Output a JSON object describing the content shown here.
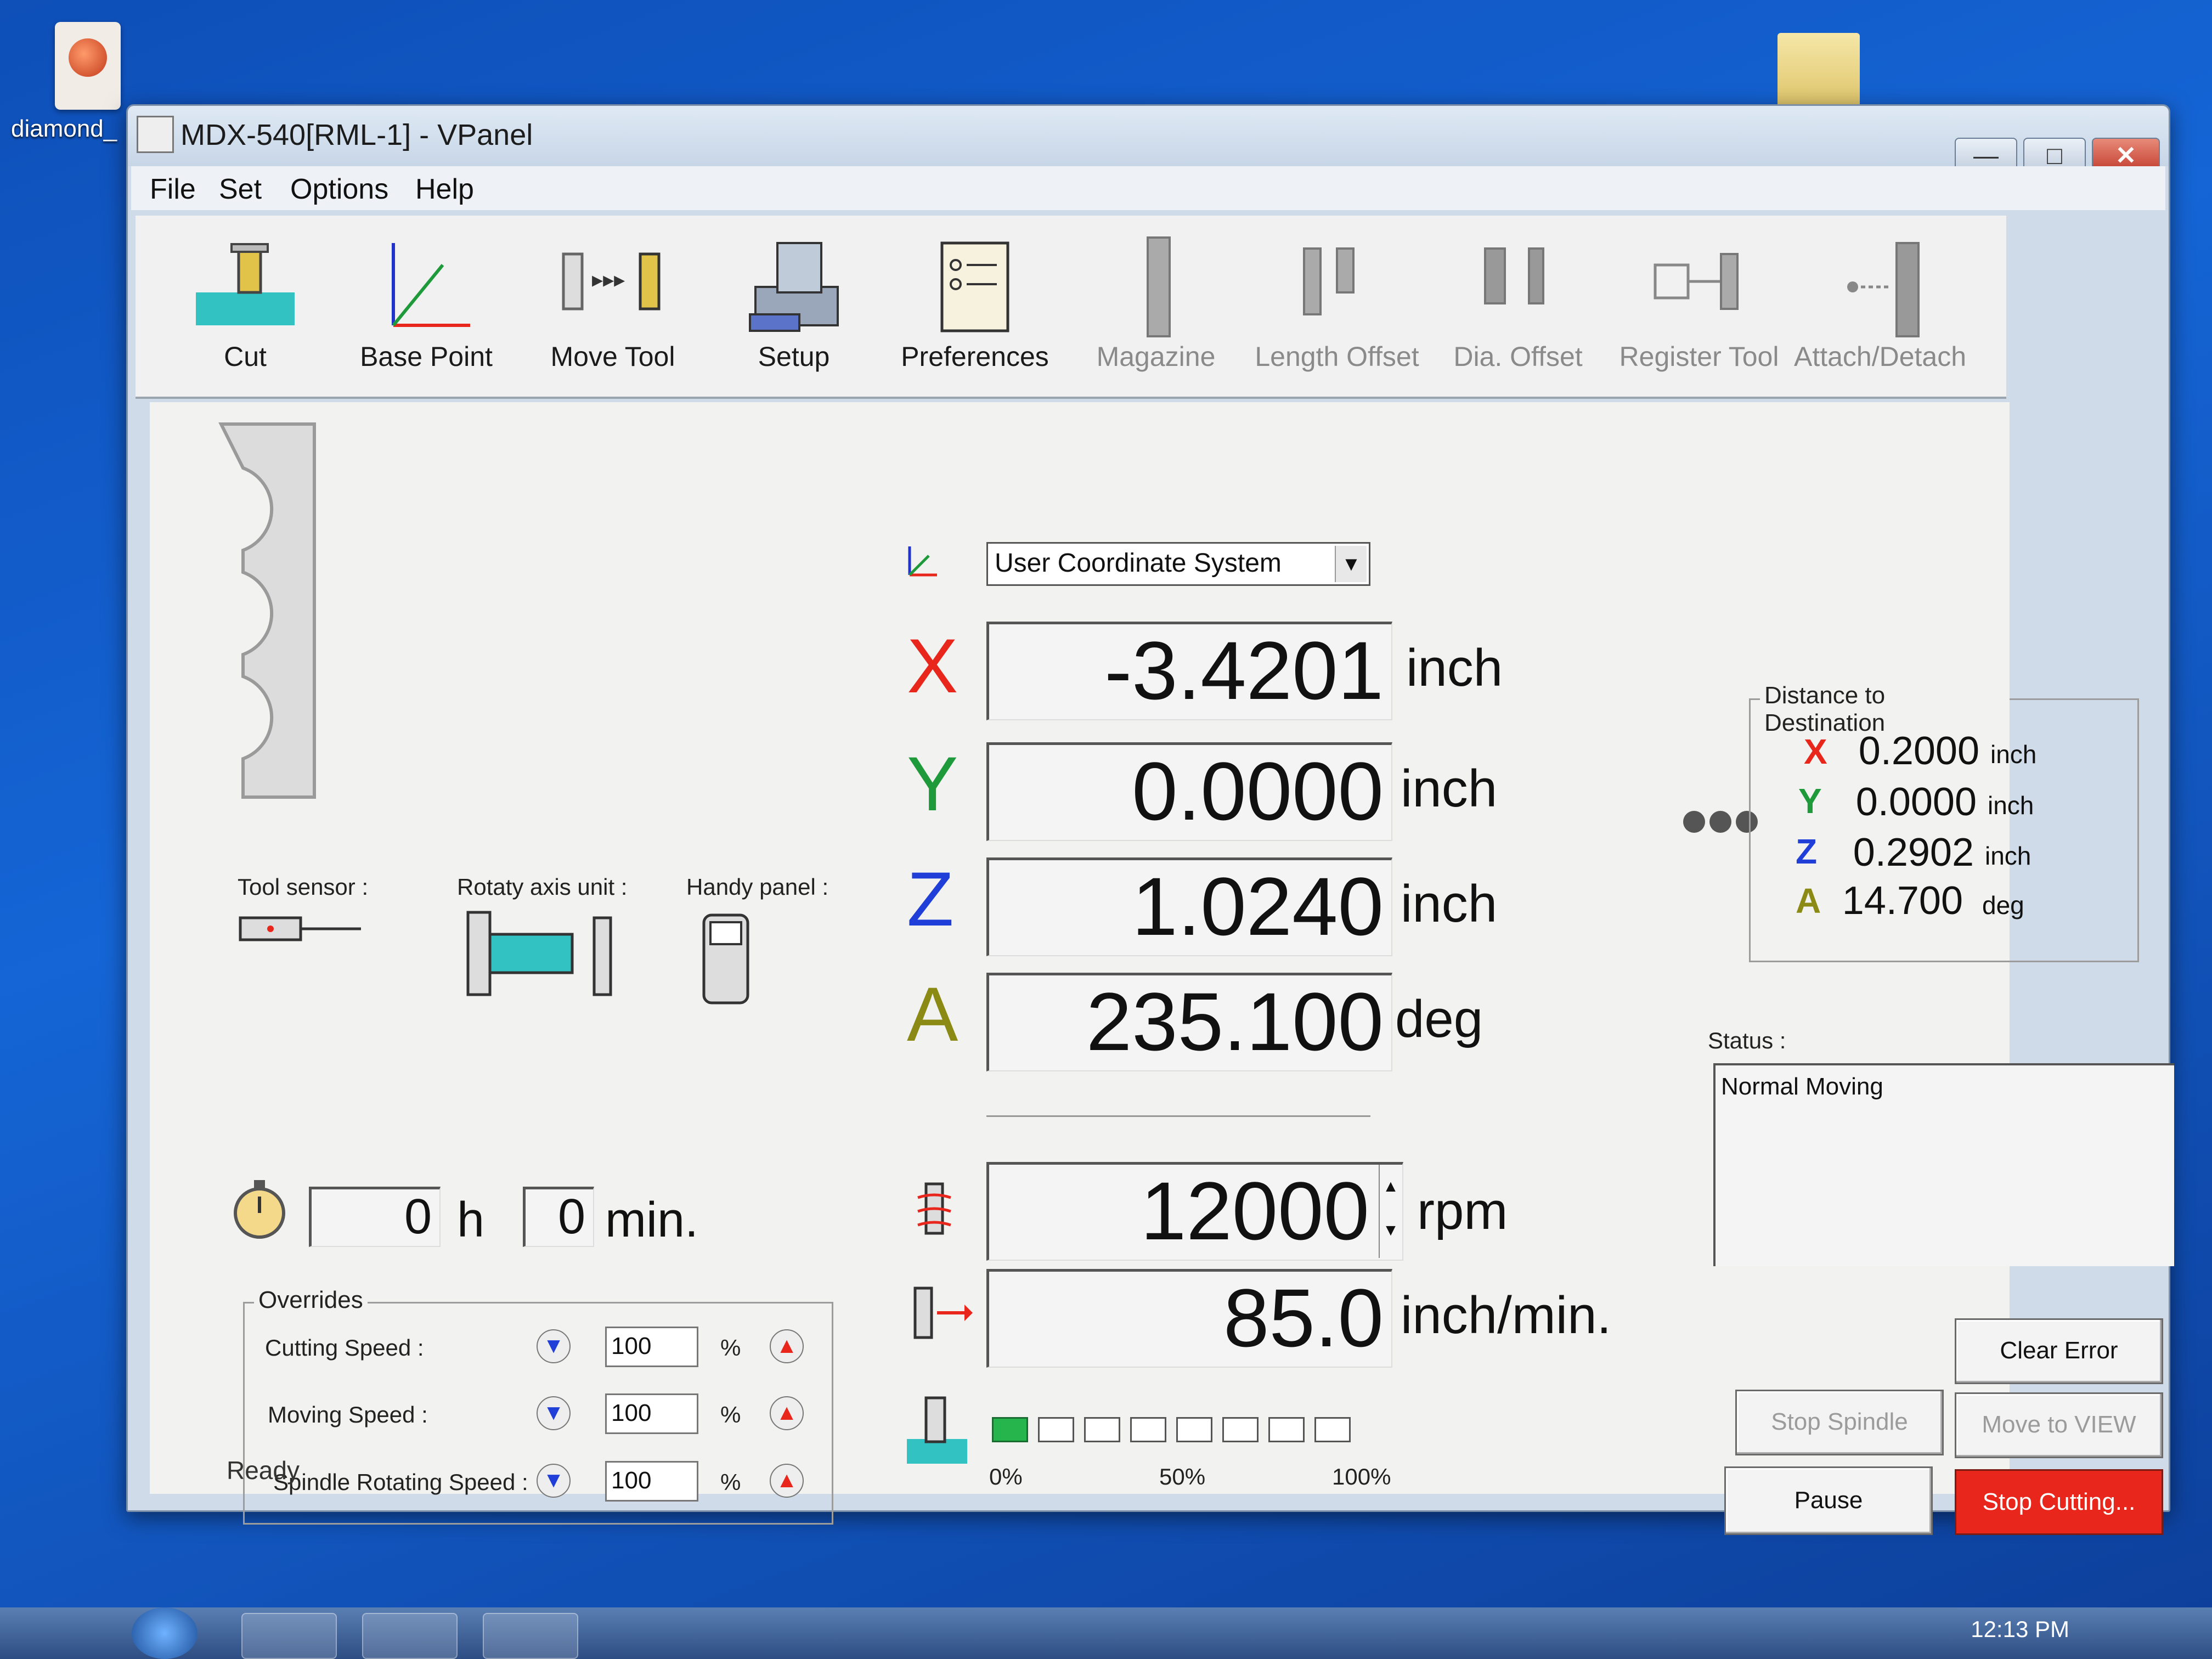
{
  "desktop": {
    "icon_label": "diamond_",
    "clock": "12:13 PM"
  },
  "window": {
    "title": "MDX-540[RML-1] - VPanel",
    "menu": [
      "File",
      "Set",
      "Options",
      "Help"
    ]
  },
  "toolbar": [
    {
      "label": "Cut",
      "icon": "cut-icon",
      "enabled": true
    },
    {
      "label": "Base Point",
      "icon": "base-point-icon",
      "enabled": true
    },
    {
      "label": "Move Tool",
      "icon": "move-tool-icon",
      "enabled": true
    },
    {
      "label": "Setup",
      "icon": "setup-icon",
      "enabled": true
    },
    {
      "label": "Preferences",
      "icon": "preferences-icon",
      "enabled": true
    },
    {
      "label": "Magazine",
      "icon": "magazine-icon",
      "enabled": false
    },
    {
      "label": "Length Offset",
      "icon": "length-offset-icon",
      "enabled": false
    },
    {
      "label": "Dia. Offset",
      "icon": "dia-offset-icon",
      "enabled": false
    },
    {
      "label": "Register Tool",
      "icon": "register-tool-icon",
      "enabled": false
    },
    {
      "label": "Attach/Detach",
      "icon": "attach-detach-icon",
      "enabled": false
    }
  ],
  "coordinate_system": "User Coordinate System",
  "axes": [
    {
      "axis": "X",
      "value": "-3.4201",
      "unit": "inch",
      "color": "#e8261c"
    },
    {
      "axis": "Y",
      "value": "0.0000",
      "unit": "inch",
      "color": "#1f9a3a"
    },
    {
      "axis": "Z",
      "value": "1.0240",
      "unit": "inch",
      "color": "#1f3fd8"
    },
    {
      "axis": "A",
      "value": "235.100",
      "unit": "deg",
      "color": "#8a8a14"
    }
  ],
  "spindle": {
    "value": "12000",
    "unit": "rpm"
  },
  "feed": {
    "value": "85.0",
    "unit": "inch/min."
  },
  "progress": {
    "filled_cells": 1,
    "total_cells": 8,
    "labels": [
      "0%",
      "50%",
      "100%"
    ]
  },
  "devices": {
    "tool_sensor": "Tool sensor :",
    "rotary_axis": "Rotaty axis unit :",
    "handy_panel": "Handy panel :"
  },
  "timer": {
    "hours": "0",
    "h_label": "h",
    "minutes": "0",
    "min_label": "min."
  },
  "overrides": {
    "title": "Overrides",
    "rows": [
      {
        "label": "Cutting Speed :",
        "value": "100",
        "unit": "%"
      },
      {
        "label": "Moving Speed :",
        "value": "100",
        "unit": "%"
      },
      {
        "label": "Spindle Rotating Speed :",
        "value": "100",
        "unit": "%"
      }
    ]
  },
  "destination": {
    "title": "Distance to Destination",
    "rows": [
      {
        "axis": "X",
        "value": "0.2000",
        "unit": "inch",
        "color": "#e8261c"
      },
      {
        "axis": "Y",
        "value": "0.0000",
        "unit": "inch",
        "color": "#1f9a3a"
      },
      {
        "axis": "Z",
        "value": "0.2902",
        "unit": "inch",
        "color": "#1f3fd8"
      },
      {
        "axis": "A",
        "value": "14.700",
        "unit": "deg",
        "color": "#8a8a14"
      }
    ]
  },
  "status": {
    "label": "Status :",
    "text": "Normal Moving"
  },
  "buttons": {
    "clear_error": "Clear Error",
    "stop_spindle": "Stop Spindle",
    "move_to_view": "Move to VIEW",
    "pause": "Pause",
    "stop_cutting": "Stop Cutting..."
  },
  "statusbar": "Ready"
}
